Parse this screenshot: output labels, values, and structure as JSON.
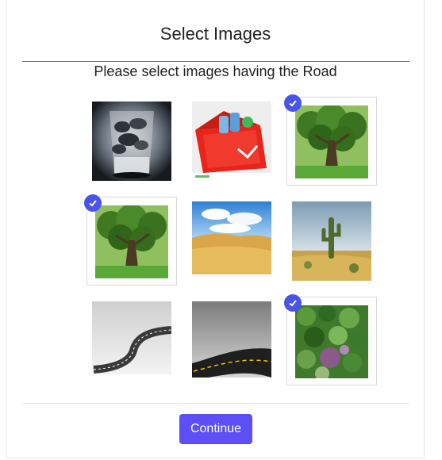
{
  "dialog": {
    "title": "Select Images",
    "prompt": "Please select images having the Road",
    "continue_label": "Continue"
  },
  "colors": {
    "accent": "#5b4ff5",
    "check": "#4a55e8",
    "divider": "#2ea043"
  },
  "tiles": [
    {
      "subject": "glass of ice water",
      "selected": false
    },
    {
      "subject": "red cooler with bottles",
      "selected": false
    },
    {
      "subject": "green tree",
      "selected": true
    },
    {
      "subject": "green tree",
      "selected": true
    },
    {
      "subject": "desert dunes",
      "selected": false
    },
    {
      "subject": "cactus in desert",
      "selected": false
    },
    {
      "subject": "winding road",
      "selected": false
    },
    {
      "subject": "curved asphalt road",
      "selected": false
    },
    {
      "subject": "green foliage wall",
      "selected": true
    }
  ]
}
